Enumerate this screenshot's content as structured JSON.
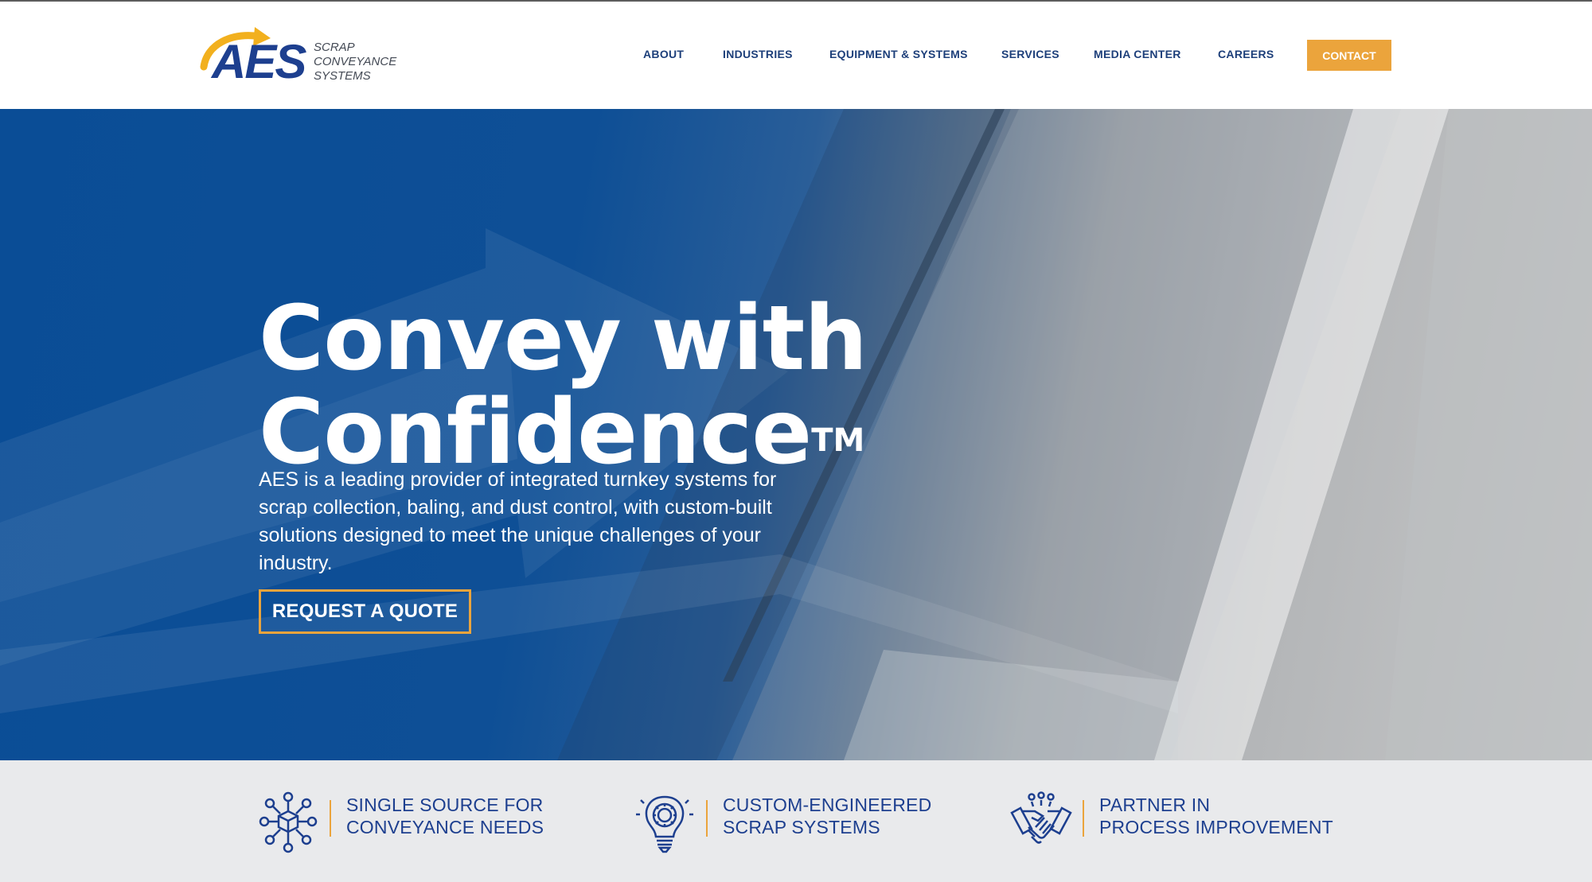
{
  "brand": {
    "logo_mark": "AES",
    "logo_sub": [
      "SCRAP",
      "CONVEYANCE",
      "SYSTEMS"
    ],
    "primary_color": "#1d3f8f",
    "accent_color": "#eba43c"
  },
  "nav": {
    "items": [
      {
        "label": "ABOUT"
      },
      {
        "label": "INDUSTRIES"
      },
      {
        "label": "EQUIPMENT & SYSTEMS"
      },
      {
        "label": "SERVICES"
      },
      {
        "label": "MEDIA CENTER"
      },
      {
        "label": "CAREERS"
      }
    ],
    "contact_label": "CONTACT"
  },
  "hero": {
    "title_line1": "Convey with",
    "title_line2": "Confidence",
    "title_tm": "TM",
    "description": "AES is a leading provider of integrated turnkey systems for scrap collection, baling, and dust control, with custom-built solutions designed to meet the unique challenges of your industry.",
    "cta_label": "REQUEST A QUOTE"
  },
  "features": [
    {
      "icon": "network-cube-icon",
      "line1": "SINGLE SOURCE FOR",
      "line2": "CONVEYANCE NEEDS"
    },
    {
      "icon": "lightbulb-gear-icon",
      "line1": "CUSTOM-ENGINEERED",
      "line2": "SCRAP SYSTEMS"
    },
    {
      "icon": "handshake-icon",
      "line1": "PARTNER IN",
      "line2": "PROCESS IMPROVEMENT"
    }
  ]
}
